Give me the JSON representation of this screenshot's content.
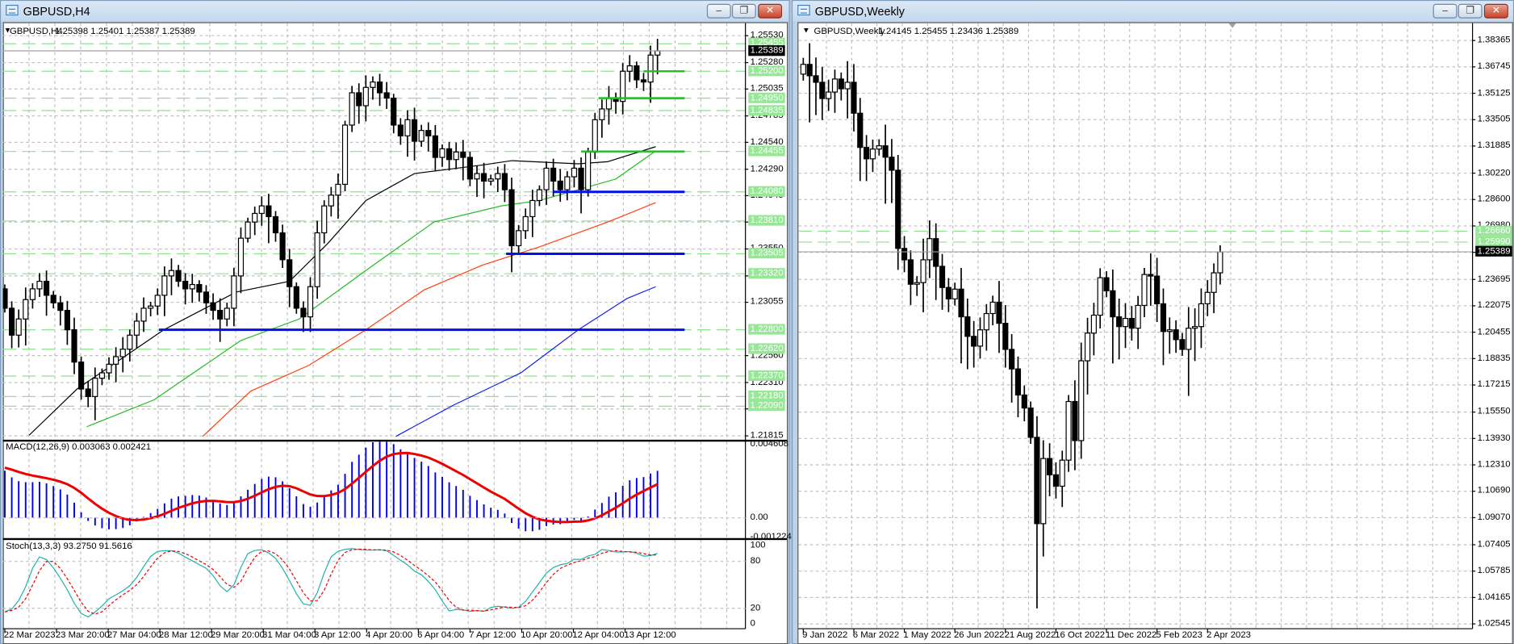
{
  "windows": {
    "left": {
      "title": "GBPUSD,H4",
      "minimize": "–",
      "restore": "❐",
      "close": "✕"
    },
    "right": {
      "title": "GBPUSD,Weekly",
      "minimize": "–",
      "restore": "❐",
      "close": "✕"
    }
  },
  "chart_data": [
    {
      "type": "candlestick",
      "title": "GBPUSD,H4",
      "header": {
        "symbol": "GBPUSD,H4",
        "ohlc": "1.25398 1.25401 1.25387 1.25389"
      },
      "current_price": "1.25389",
      "price_axis": {
        "ticks": [
          "1.25530",
          "1.25280",
          "1.25035",
          "1.24785",
          "1.24540",
          "1.24290",
          "1.24045",
          "1.23800",
          "1.23550",
          "1.23300",
          "1.23055",
          "1.22560",
          "1.22310",
          "1.22065",
          "1.21815"
        ],
        "highlighted": [
          "1.25455",
          "1.25200",
          "1.24950",
          "1.24835",
          "1.24455",
          "1.24080",
          "1.23810",
          "1.23505",
          "1.23320",
          "1.22800",
          "1.22620",
          "1.22370",
          "1.22180",
          "1.22090"
        ]
      },
      "time_labels": [
        "22 Mar 2023",
        "23 Mar 20:00",
        "27 Mar 04:00",
        "28 Mar 12:00",
        "29 Mar 20:00",
        "31 Mar 04:00",
        "3 Apr 12:00",
        "4 Apr 20:00",
        "6 Apr 04:00",
        "7 Apr 12:00",
        "10 Apr 20:00",
        "12 Apr 04:00",
        "13 Apr 12:00"
      ],
      "closes": [
        1.23,
        1.2275,
        1.229,
        1.2308,
        1.2318,
        1.2325,
        1.2312,
        1.2305,
        1.2298,
        1.228,
        1.225,
        1.2225,
        1.2218,
        1.2235,
        1.224,
        1.2248,
        1.2255,
        1.2262,
        1.2275,
        1.2288,
        1.23,
        1.2302,
        1.2312,
        1.233,
        1.2335,
        1.2325,
        1.2318,
        1.2322,
        1.2315,
        1.2305,
        1.2298,
        1.229,
        1.23,
        1.233,
        1.2365,
        1.238,
        1.2388,
        1.2395,
        1.2385,
        1.237,
        1.2345,
        1.232,
        1.23,
        1.2292,
        1.232,
        1.237,
        1.2395,
        1.2405,
        1.2415,
        1.247,
        1.25,
        1.2488,
        1.2505,
        1.251,
        1.25,
        1.2495,
        1.247,
        1.246,
        1.2475,
        1.2455,
        1.2465,
        1.246,
        1.244,
        1.2448,
        1.2438,
        1.2445,
        1.244,
        1.242,
        1.2425,
        1.2418,
        1.242,
        1.2425,
        1.241,
        1.2358,
        1.2372,
        1.2385,
        1.24,
        1.241,
        1.243,
        1.2418,
        1.241,
        1.2422,
        1.243,
        1.241,
        1.2445,
        1.2475,
        1.2485,
        1.2495,
        1.2492,
        1.252,
        1.2525,
        1.2512,
        1.251,
        1.2535,
        1.25389
      ],
      "first_open": 1.2318,
      "moving_averages": [
        {
          "color": "#000000",
          "points": [
            [
              3.5,
              1.2182
            ],
            [
              10.4,
              1.2225
            ],
            [
              22.9,
              1.228
            ],
            [
              33.3,
              1.2315
            ],
            [
              41,
              1.2325
            ],
            [
              46.5,
              1.236
            ],
            [
              52,
              1.24
            ],
            [
              59,
              1.2425
            ],
            [
              68.8,
              1.2433
            ],
            [
              73,
              1.2437
            ],
            [
              82.6,
              1.2434
            ],
            [
              86.8,
              1.2436
            ],
            [
              93.75,
              1.245
            ]
          ]
        },
        {
          "color": "#22bb22",
          "points": [
            [
              11.8,
              1.219
            ],
            [
              21.5,
              1.2215
            ],
            [
              34,
              1.227
            ],
            [
              42.4,
              1.229
            ],
            [
              52,
              1.2335
            ],
            [
              61.8,
              1.238
            ],
            [
              71.5,
              1.2395
            ],
            [
              77,
              1.24
            ],
            [
              82.6,
              1.241
            ],
            [
              88,
              1.242
            ],
            [
              93.75,
              1.2446
            ]
          ]
        },
        {
          "color": "#ff4010",
          "points": [
            [
              28.5,
              1.2181
            ],
            [
              35.4,
              1.2223
            ],
            [
              43.8,
              1.2247
            ],
            [
              52,
              1.228
            ],
            [
              60.4,
              1.2317
            ],
            [
              68.8,
              1.234
            ],
            [
              77,
              1.2357
            ],
            [
              86.8,
              1.238
            ],
            [
              93.75,
              1.2398
            ]
          ]
        },
        {
          "color": "#1020ee",
          "points": [
            [
              56.3,
              1.2181
            ],
            [
              64.6,
              1.221
            ],
            [
              74.3,
              1.224
            ],
            [
              82.6,
              1.228
            ],
            [
              89.6,
              1.2309
            ],
            [
              93.75,
              1.232
            ]
          ]
        }
      ],
      "levels": [
        {
          "price": 1.252,
          "color": "#22bb22",
          "from_bar": 92
        },
        {
          "price": 1.2495,
          "color": "#22bb22",
          "from_bar": 85.5
        },
        {
          "price": 1.24455,
          "color": "#22bb22",
          "from_bar": 83
        },
        {
          "price": 1.2408,
          "color": "#0010ee",
          "from_bar": 79
        },
        {
          "price": 1.23505,
          "color": "#0010ee",
          "from_bar": 72.2
        },
        {
          "price": 1.228,
          "color": "#0010ee",
          "from_bar": 22.2
        }
      ],
      "macd": {
        "label": "MACD(12,26,9) 0.003063 0.002421",
        "axis": [
          "0.004608",
          "0.00",
          "-0.001224"
        ],
        "hist_color": "#0000ee",
        "signal_color": "#ee0000"
      },
      "stoch": {
        "label": "Stoch(13,3,3) 93.2750 91.5616",
        "axis": [
          "100",
          "80",
          "20",
          "0"
        ],
        "k_color": "#20b2aa",
        "d_color": "#ee0000"
      }
    },
    {
      "type": "candlestick",
      "title": "GBPUSD,Weekly",
      "header": {
        "symbol": "GBPUSD,Weekly",
        "ohlc": "1.24145 1.25455 1.23436 1.25389"
      },
      "current_price": "1.25389",
      "price_axis": {
        "ticks": [
          "1.38365",
          "1.36745",
          "1.35125",
          "1.33505",
          "1.31885",
          "1.30220",
          "1.28600",
          "1.26980",
          "1.25360",
          "1.23695",
          "1.22075",
          "1.20455",
          "1.18835",
          "1.17215",
          "1.15550",
          "1.13930",
          "1.12310",
          "1.10690",
          "1.09070",
          "1.07405",
          "1.05785",
          "1.04165",
          "1.02545"
        ],
        "highlighted": [
          "1.26660",
          "1.25990"
        ]
      },
      "time_labels": [
        "9 Jan 2022",
        "6 Mar 2022",
        "1 May 2022",
        "26 Jun 2022",
        "21 Aug 2022",
        "16 Oct 2022",
        "11 Dec 2022",
        "5 Feb 2023",
        "2 Apr 2023"
      ],
      "closes": [
        1.369,
        1.362,
        1.358,
        1.348,
        1.352,
        1.36,
        1.354,
        1.358,
        1.339,
        1.318,
        1.311,
        1.317,
        1.319,
        1.312,
        1.304,
        1.256,
        1.249,
        1.234,
        1.235,
        1.249,
        1.262,
        1.245,
        1.232,
        1.225,
        1.231,
        1.214,
        1.202,
        1.196,
        1.206,
        1.216,
        1.223,
        1.21,
        1.194,
        1.182,
        1.166,
        1.158,
        1.14,
        1.087,
        1.127,
        1.117,
        1.11,
        1.126,
        1.162,
        1.138,
        1.187,
        1.204,
        1.215,
        1.238,
        1.23,
        1.214,
        1.208,
        1.213,
        1.207,
        1.221,
        1.24,
        1.239,
        1.222,
        1.205,
        1.206,
        1.2,
        1.194,
        1.207,
        1.208,
        1.222,
        1.229,
        1.241,
        1.25389
      ],
      "first_open": 1.363,
      "low_overrides": {
        "37": 1.035
      }
    }
  ]
}
